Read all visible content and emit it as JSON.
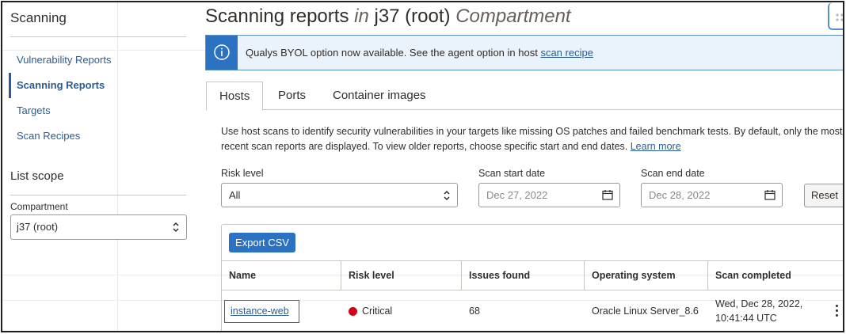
{
  "sidebar": {
    "title": "Scanning",
    "items": [
      {
        "label": "Vulnerability Reports"
      },
      {
        "label": "Scanning Reports"
      },
      {
        "label": "Targets"
      },
      {
        "label": "Scan Recipes"
      }
    ],
    "active_index": 1,
    "list_scope_title": "List scope",
    "compartment_label": "Compartment",
    "compartment_value": "j37 (root)"
  },
  "header": {
    "title_main": "Scanning reports",
    "title_in": "in",
    "title_compartment": "j37 (root)",
    "title_suffix": "Compartment"
  },
  "banner": {
    "icon": "info-icon",
    "text": "Qualys BYOL option now available. See the agent option in host",
    "link": "scan recipe"
  },
  "tabs": [
    {
      "label": "Hosts",
      "active": true
    },
    {
      "label": "Ports",
      "active": false
    },
    {
      "label": "Container images",
      "active": false
    }
  ],
  "description": {
    "text": "Use host scans to identify security vulnerabilities in your targets like missing OS patches and failed benchmark tests. By default, only the most recent scan reports are displayed. To view older reports, choose specific start and end dates.",
    "link": "Learn more"
  },
  "filters": {
    "risk_level_label": "Risk level",
    "risk_level_value": "All",
    "start_label": "Scan start date",
    "start_value": "Dec 27, 2022",
    "end_label": "Scan end date",
    "end_value": "Dec 28, 2022",
    "reset_label": "Reset"
  },
  "table": {
    "export_label": "Export CSV",
    "columns": [
      "Name",
      "Risk level",
      "Issues found",
      "Operating system",
      "Scan completed"
    ],
    "rows": [
      {
        "name": "instance-web",
        "risk_level": "Critical",
        "risk_color": "#d0021b",
        "issues": "68",
        "os": "Oracle Linux Server_8.6",
        "completed_line1": "Wed, Dec 28, 2022,",
        "completed_line2": "10:41:44 UTC"
      }
    ]
  },
  "colors": {
    "accent": "#2b73c2",
    "link": "#2c5c8f",
    "critical": "#d0021b"
  }
}
